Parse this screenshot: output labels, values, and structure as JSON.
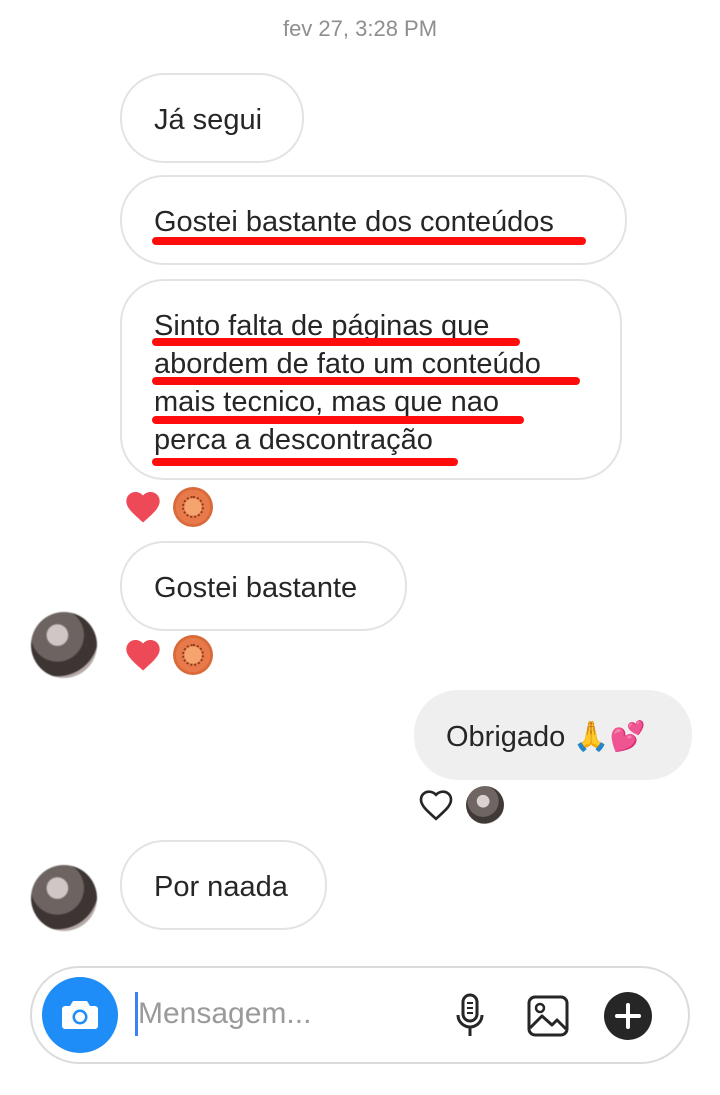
{
  "timestamp": "fev 27, 3:28 PM",
  "messages": {
    "m1": "Já segui",
    "m2": "Gostei bastante dos conteúdos",
    "m3_lines": [
      "Sinto falta de páginas que",
      "abordem de fato um conteúdo",
      "mais tecnico, mas que nao",
      "perca a descontração"
    ],
    "m4": "Gostei bastante",
    "m5": "Obrigado 🙏💕",
    "m6": "Por naada"
  },
  "reactions": {
    "heart_color": "#ed4956",
    "annotation_underline_color": "#ff0d0d"
  },
  "composer": {
    "placeholder": "Mensagem...",
    "value": "",
    "accent": "#1f8df7",
    "icons": [
      "camera-icon",
      "microphone-icon",
      "image-icon",
      "plus-icon"
    ]
  }
}
